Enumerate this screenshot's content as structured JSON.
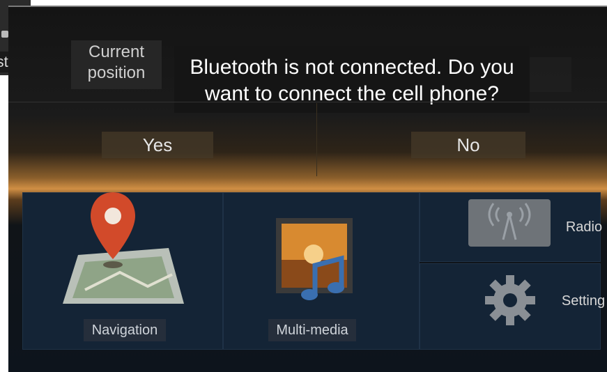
{
  "left_tab": {
    "label": "ste"
  },
  "screen": {
    "current_position": "Current position",
    "dialog": {
      "message": "Bluetooth is not connected. Do you want to connect the cell phone?",
      "yes_label": "Yes",
      "no_label": "No"
    },
    "tiles": {
      "navigation": {
        "label": "Navigation",
        "icon": "map-pin-icon"
      },
      "multimedia": {
        "label": "Multi-media",
        "icon": "music-photo-icon"
      },
      "radio": {
        "label": "Radio",
        "icon": "radio-tower-icon"
      },
      "setting": {
        "label": "Setting",
        "icon": "gear-icon"
      }
    }
  },
  "colors": {
    "accent": "#d08f44",
    "pin": "#d24a2a",
    "tile_bg": "#142436"
  }
}
